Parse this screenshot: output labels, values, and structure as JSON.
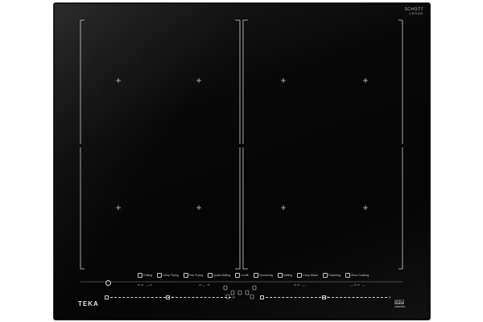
{
  "brand": {
    "maker": "TEKA",
    "glass_line1": "SCHOTT",
    "glass_line2": "CERAN",
    "technology_line1": "DIRECT",
    "technology_line2": "SENSE",
    "technology_line3": "induction"
  },
  "functions": [
    {
      "label": "Grilling",
      "icon": "grill-icon"
    },
    {
      "label": "Deep Frying",
      "icon": "pot-icon"
    },
    {
      "label": "Pan Frying",
      "icon": "pan-icon"
    },
    {
      "label": "Quick Boiling",
      "icon": "boil-icon"
    },
    {
      "label": "Confit",
      "icon": "confit-icon"
    },
    {
      "label": "Simmering",
      "icon": "simmer-icon"
    },
    {
      "label": "Melting",
      "icon": "melt-icon"
    },
    {
      "label": "Keep Warm",
      "icon": "warm-icon"
    },
    {
      "label": "Poaching",
      "icon": "poach-icon"
    },
    {
      "label": "Slow Cooking",
      "icon": "slow-cook-icon"
    }
  ],
  "colors": {
    "glass": "#050505",
    "markings": "#d0d0d0"
  }
}
